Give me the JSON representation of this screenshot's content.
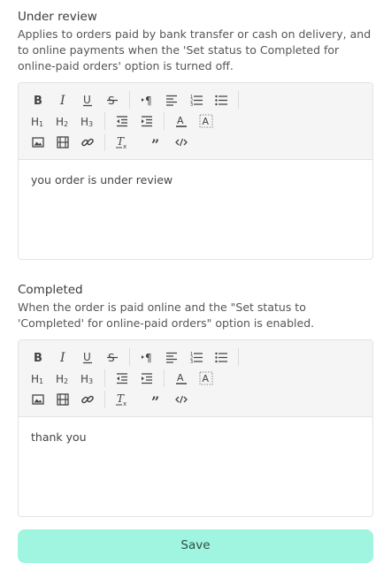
{
  "under_review": {
    "title": "Under review",
    "description": "Applies to orders paid by bank transfer or cash on delivery, and to online payments when the 'Set status to Completed for online-paid orders' option is turned off.",
    "content": "you order is under review"
  },
  "completed": {
    "title": "Completed",
    "description": "When the order is paid online and the \"Set status to 'Completed' for online-paid orders\" option is enabled.",
    "content": "thank you"
  },
  "save_label": "Save"
}
